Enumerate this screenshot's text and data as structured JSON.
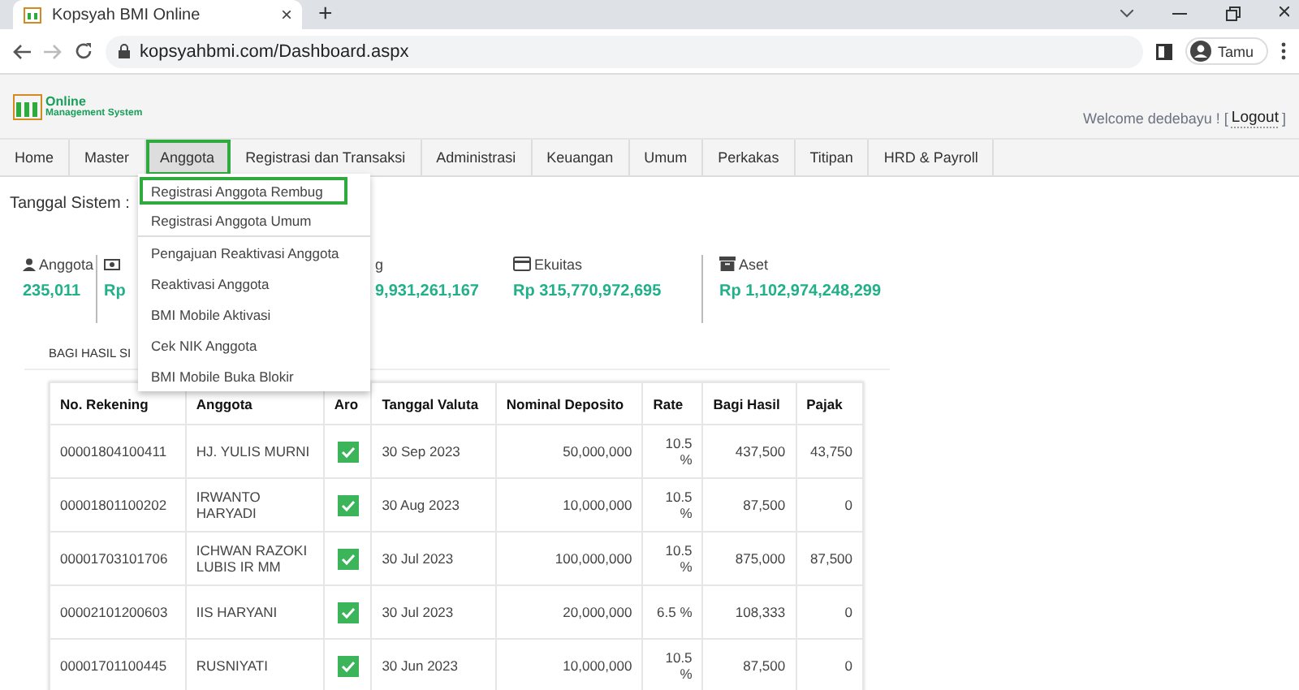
{
  "browser": {
    "tab_title": "Kopsyah BMI Online",
    "tab_close": "×",
    "new_tab": "+",
    "url": "kopsyahbmi.com/Dashboard.aspx",
    "profile": "Tamu"
  },
  "header": {
    "logo_line1": "Online",
    "logo_line2": "Management System",
    "welcome": "Welcome dedebayu ! [",
    "logout": "Logout",
    "welcome_end": "]"
  },
  "nav": [
    {
      "label": "Home",
      "selected": false
    },
    {
      "label": "Master",
      "selected": false
    },
    {
      "label": "Anggota",
      "selected": true
    },
    {
      "label": "Registrasi dan Transaksi",
      "selected": false
    },
    {
      "label": "Administrasi",
      "selected": false
    },
    {
      "label": "Keuangan",
      "selected": false
    },
    {
      "label": "Umum",
      "selected": false
    },
    {
      "label": "Perkakas",
      "selected": false
    },
    {
      "label": "Titipan",
      "selected": false
    },
    {
      "label": "HRD & Payroll",
      "selected": false
    }
  ],
  "dropdown": [
    {
      "label": "Registrasi Anggota Rembug",
      "selected": true,
      "divider_after": false
    },
    {
      "label": "Registrasi Anggota Umum",
      "selected": false,
      "divider_after": true
    },
    {
      "label": "Pengajuan Reaktivasi Anggota",
      "selected": false,
      "divider_after": false
    },
    {
      "label": "Reaktivasi Anggota",
      "selected": false,
      "divider_after": false
    },
    {
      "label": "BMI Mobile Aktivasi",
      "selected": false,
      "divider_after": false
    },
    {
      "label": "Cek NIK Anggota",
      "selected": false,
      "divider_after": false
    },
    {
      "label": "BMI Mobile Buka Blokir",
      "selected": false,
      "divider_after": false
    }
  ],
  "system_date_label": "Tanggal Sistem : ",
  "stats": [
    {
      "kind": "person",
      "label": "Anggota",
      "value": "235,011"
    },
    {
      "kind": "money",
      "value": "Rp"
    },
    {
      "kind": "none",
      "label": "g",
      "value": "9,931,261,167"
    },
    {
      "kind": "card",
      "label": "Ekuitas",
      "value": "Rp 315,770,972,695"
    },
    {
      "kind": "archive",
      "label": "Aset",
      "value": "Rp 1,102,974,248,299"
    }
  ],
  "section_title": "BAGI HASIL SI",
  "table": {
    "columns": [
      "No. Rekening",
      "Anggota",
      "Aro",
      "Tanggal Valuta",
      "Nominal Deposito",
      "Rate",
      "Bagi Hasil",
      "Pajak"
    ],
    "rows": [
      {
        "rekening": "00001804100411",
        "anggota": "HJ. YULIS MURNI",
        "aro": true,
        "tanggal": "30 Sep 2023",
        "nominal": "50,000,000",
        "rate": "10.5 %",
        "bagi_hasil": "437,500",
        "pajak": "43,750"
      },
      {
        "rekening": "00001801100202",
        "anggota": "IRWANTO HARYADI",
        "aro": true,
        "tanggal": "30 Aug 2023",
        "nominal": "10,000,000",
        "rate": "10.5 %",
        "bagi_hasil": "87,500",
        "pajak": "0"
      },
      {
        "rekening": "00001703101706",
        "anggota": "ICHWAN RAZOKI LUBIS IR MM",
        "aro": true,
        "tanggal": "30 Jul 2023",
        "nominal": "100,000,000",
        "rate": "10.5 %",
        "bagi_hasil": "875,000",
        "pajak": "87,500"
      },
      {
        "rekening": "00002101200603",
        "anggota": "IIS HARYANI",
        "aro": true,
        "tanggal": "30 Jul 2023",
        "nominal": "20,000,000",
        "rate": "6.5 %",
        "bagi_hasil": "108,333",
        "pajak": "0"
      },
      {
        "rekening": "00001701100445",
        "anggota": "RUSNIYATI",
        "aro": true,
        "tanggal": "30 Jun 2023",
        "nominal": "10,000,000",
        "rate": "10.5 %",
        "bagi_hasil": "87,500",
        "pajak": "0"
      }
    ]
  }
}
